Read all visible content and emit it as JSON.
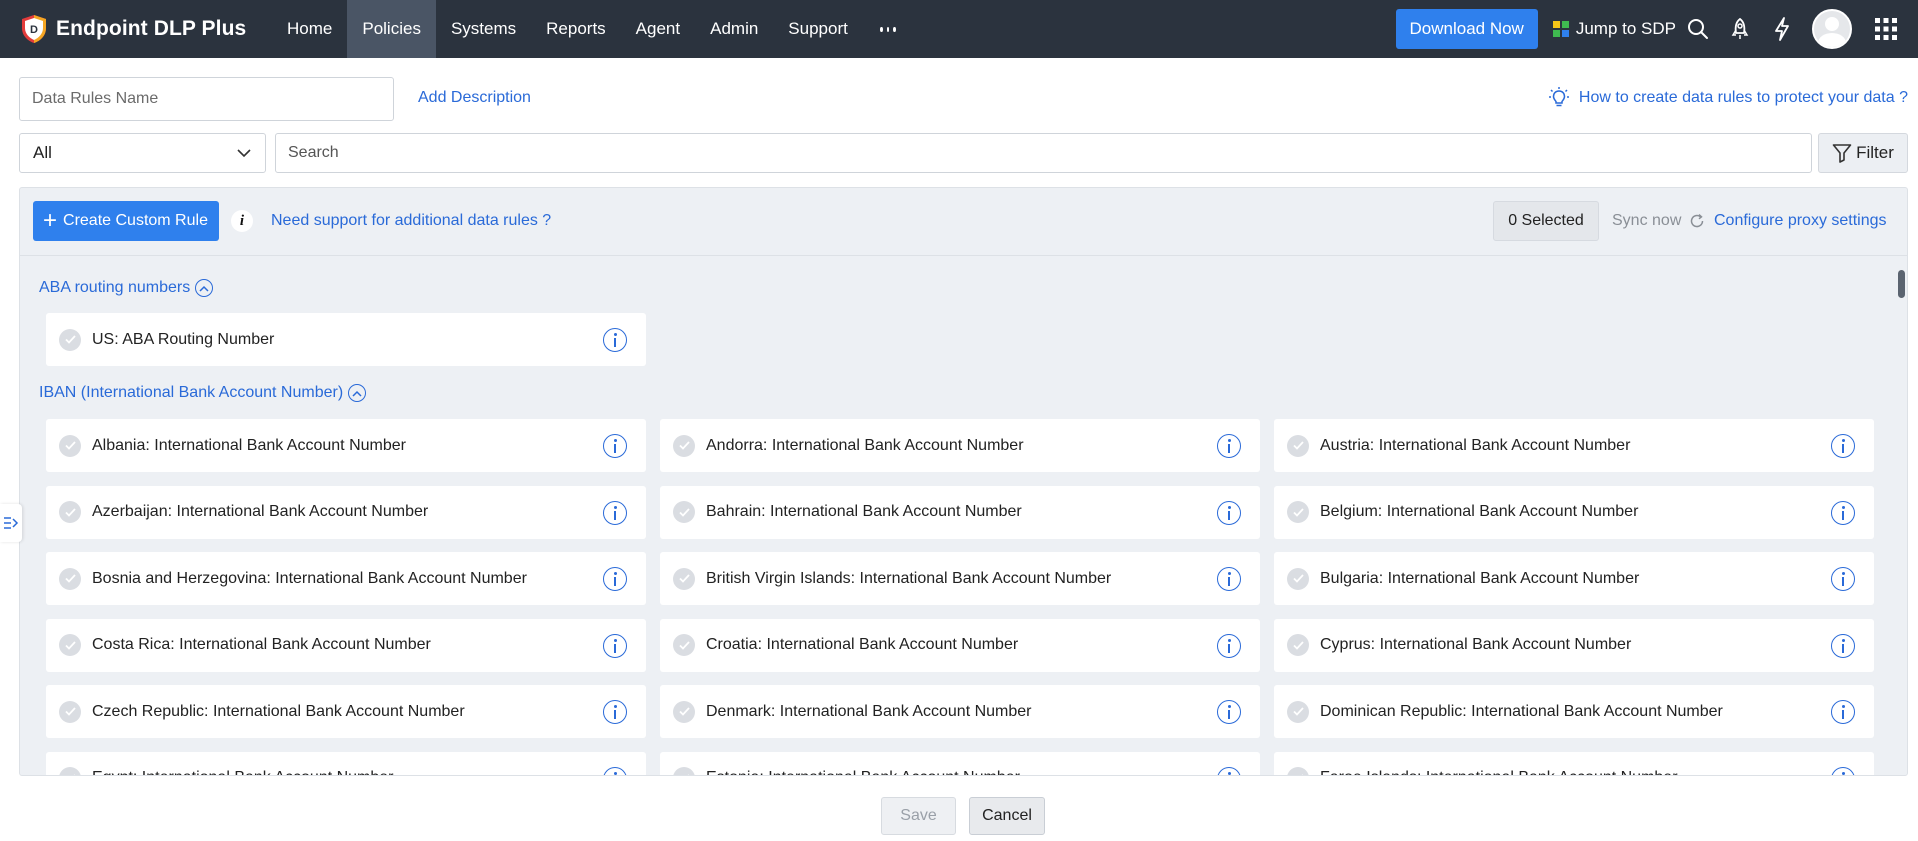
{
  "brand": {
    "name": "Endpoint DLP Plus",
    "logo_letter": "D"
  },
  "nav": {
    "items": [
      {
        "label": "Home",
        "active": false
      },
      {
        "label": "Policies",
        "active": true
      },
      {
        "label": "Systems",
        "active": false
      },
      {
        "label": "Reports",
        "active": false
      },
      {
        "label": "Agent",
        "active": false
      },
      {
        "label": "Admin",
        "active": false
      },
      {
        "label": "Support",
        "active": false
      }
    ],
    "more_icon": "more-horizontal-icon",
    "download_label": "Download Now",
    "jump_label": "Jump to SDP",
    "icons": [
      "search-icon",
      "rocket-icon",
      "lightning-icon",
      "avatar",
      "apps-grid-icon"
    ]
  },
  "form": {
    "name_placeholder": "Data Rules Name",
    "add_description": "Add Description",
    "how_to": "How to create data rules to protect your data ?",
    "category_select": "All",
    "search_placeholder": "Search",
    "filter_label": "Filter"
  },
  "toolbar": {
    "create_label": "Create Custom Rule",
    "info_glyph": "i",
    "need_support": "Need support for additional data rules ?",
    "selected": "0 Selected",
    "sync_now": "Sync now",
    "configure_proxy": "Configure proxy settings"
  },
  "groups": [
    {
      "title": "ABA routing numbers",
      "rules": [
        "US: ABA Routing Number"
      ]
    },
    {
      "title": "IBAN (International Bank Account Number)",
      "rules": [
        "Albania: International Bank Account Number",
        "Andorra: International Bank Account Number",
        "Austria: International Bank Account Number",
        "Azerbaijan: International Bank Account Number",
        "Bahrain: International Bank Account Number",
        "Belgium: International Bank Account Number",
        "Bosnia and Herzegovina: International Bank Account Number",
        "British Virgin Islands: International Bank Account Number",
        "Bulgaria: International Bank Account Number",
        "Costa Rica: International Bank Account Number",
        "Croatia: International Bank Account Number",
        "Cyprus: International Bank Account Number",
        "Czech Republic: International Bank Account Number",
        "Denmark: International Bank Account Number",
        "Dominican Republic: International Bank Account Number",
        "Egypt: International Bank Account Number",
        "Estonia: International Bank Account Number",
        "Faroe Islands: International Bank Account Number"
      ]
    }
  ],
  "footer": {
    "save_label": "Save",
    "cancel_label": "Cancel"
  },
  "colors": {
    "nav_bg": "#2b333e",
    "accent": "#2f80ed",
    "link": "#2a6ad8",
    "panel_bg": "#edf0f4"
  }
}
